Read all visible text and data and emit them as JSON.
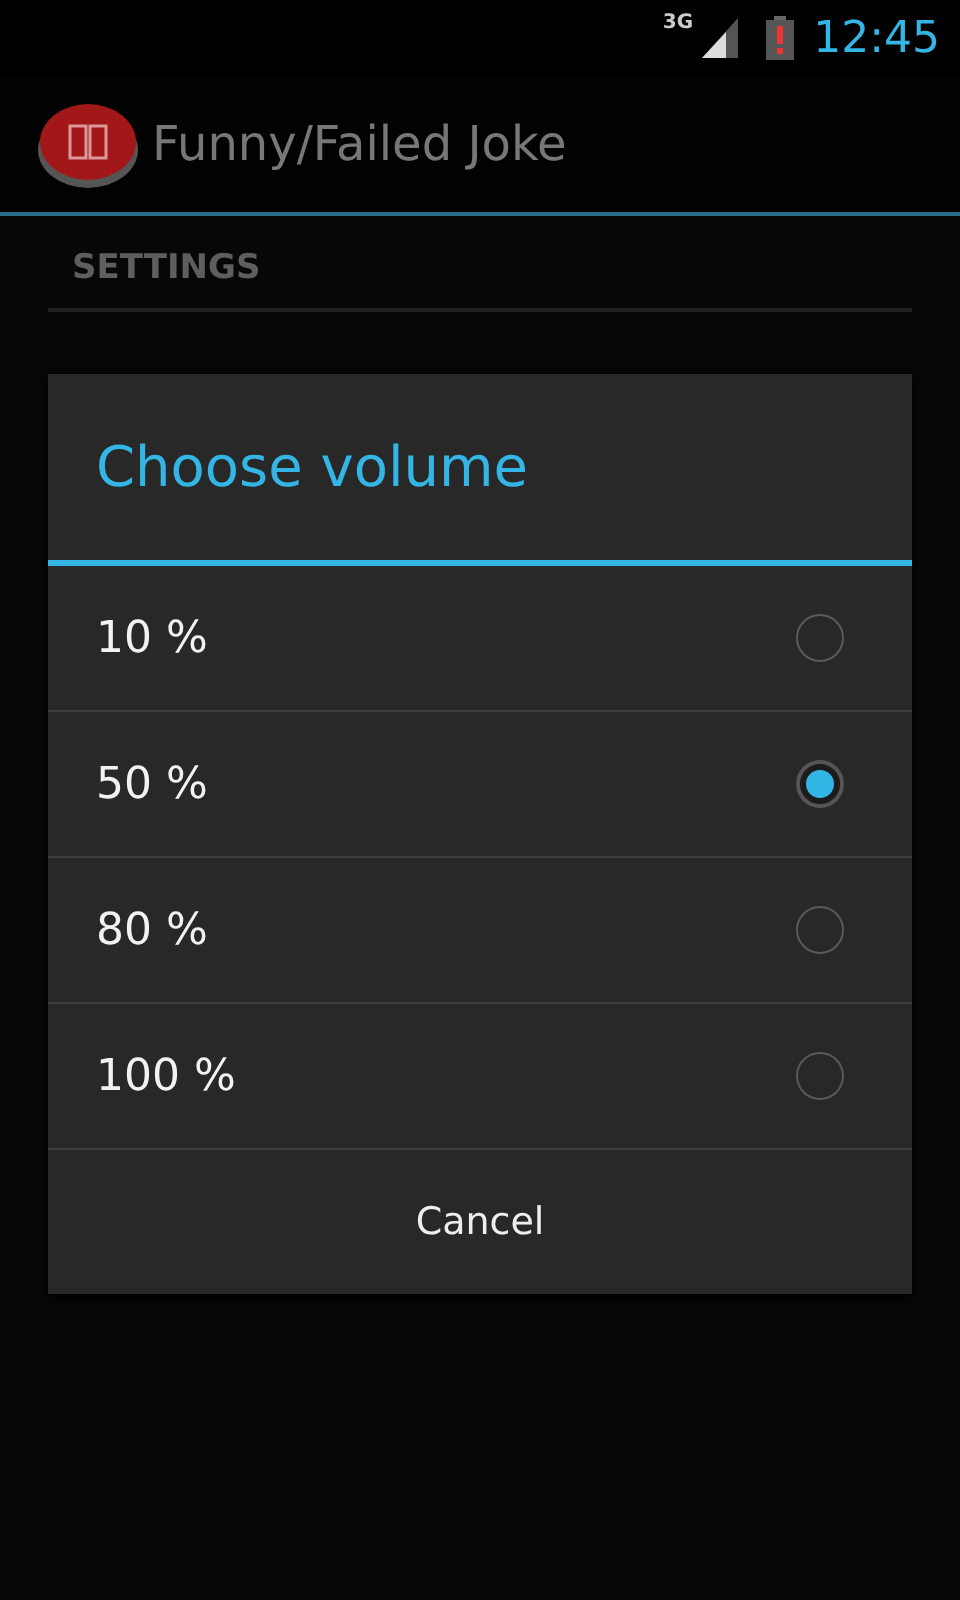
{
  "status_bar": {
    "network": "3G",
    "time": "12:45"
  },
  "action_bar": {
    "title": "Funny/Failed Joke"
  },
  "settings": {
    "header": "SETTINGS"
  },
  "dialog": {
    "title": "Choose volume",
    "options": [
      {
        "label": "10 %",
        "selected": false
      },
      {
        "label": "50 %",
        "selected": true
      },
      {
        "label": "80 %",
        "selected": false
      },
      {
        "label": "100 %",
        "selected": false
      }
    ],
    "buttons": [
      "Cancel"
    ]
  }
}
